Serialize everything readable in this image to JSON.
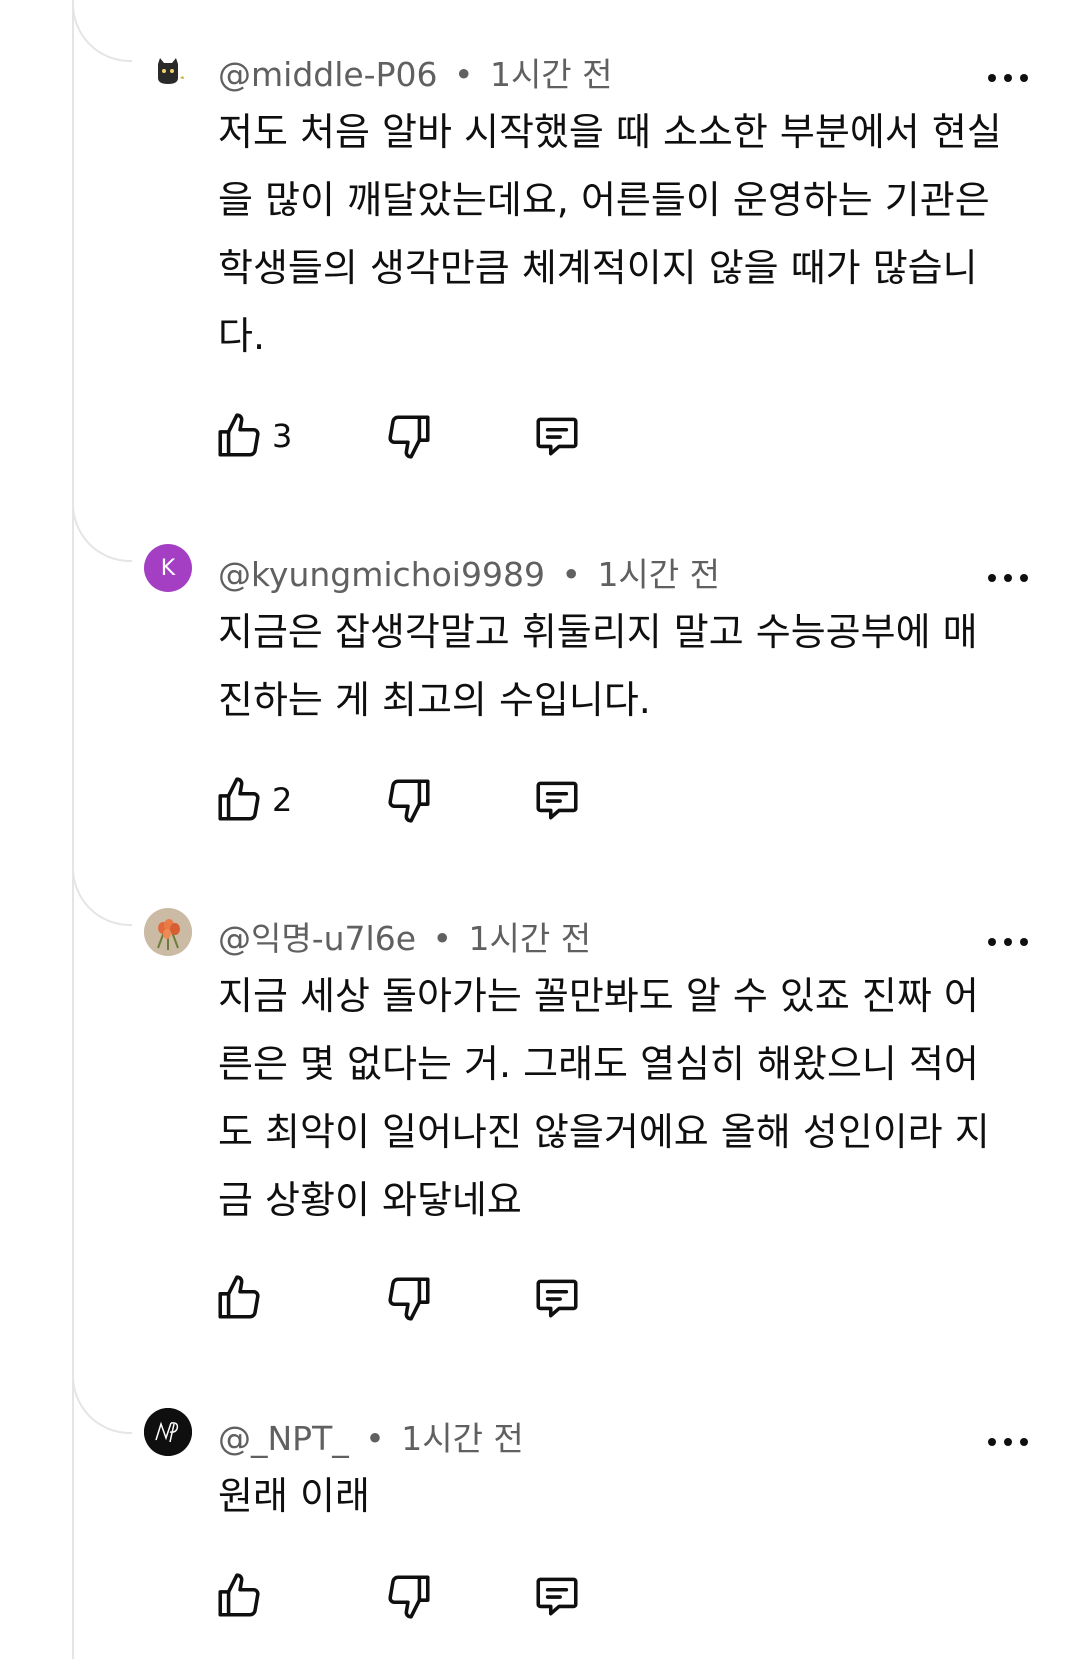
{
  "comments": [
    {
      "author": "@middle-P06",
      "time": "1시간 전",
      "avatar_icon": "cat-avatar-icon",
      "text": "저도 처음 알바 시작했을 때 소소한 부분에서 현실을 많이 깨달았는데요, 어른들이 운영하는 기관은 학생들의 생각만큼 체계적이지 않을 때가 많습니다.",
      "likes": "3"
    },
    {
      "author": "@kyungmichoi9989",
      "time": "1시간 전",
      "avatar_letter": "K",
      "avatar_color": "#a43fc4",
      "text": "지금은 잡생각말고 휘둘리지 말고 수능공부에 매진하는 게 최고의 수입니다.",
      "likes": "2"
    },
    {
      "author": "@익명-u7l6e",
      "time": "1시간 전",
      "avatar_icon": "tulip-photo-avatar",
      "text": "지금 세상 돌아가는 꼴만봐도 알 수 있죠 진짜 어른은 몇 없다는 거. 그래도 열심히 해왔으니 적어도 최악이 일어나진 않을거에요 올해 성인이라 지금 상황이 와닿네요",
      "likes": ""
    },
    {
      "author": "@_NPT_",
      "time": "1시간 전",
      "avatar_icon": "npt-logo-avatar",
      "text": "원래 이래",
      "likes": ""
    }
  ],
  "separator": "•",
  "icons": {
    "like": "thumbs-up-icon",
    "dislike": "thumbs-down-icon",
    "reply": "reply-comment-icon",
    "more": "more-options-icon"
  }
}
